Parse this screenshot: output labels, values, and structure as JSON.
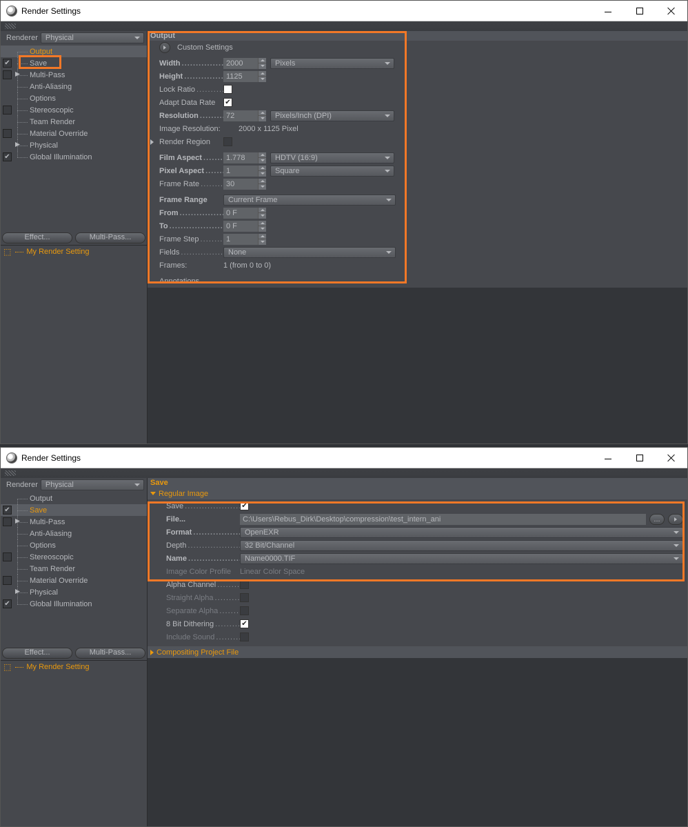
{
  "window1": {
    "title": "Render Settings",
    "renderer_label": "Renderer",
    "renderer_value": "Physical",
    "tree": [
      {
        "key": "output",
        "label": "Output",
        "checked": null,
        "accent": true,
        "bold": false,
        "selected": true,
        "expander": false
      },
      {
        "key": "save",
        "label": "Save",
        "checked": true,
        "accent": false,
        "bold": false,
        "selected": false,
        "expander": false
      },
      {
        "key": "multipass",
        "label": "Multi-Pass",
        "checked": false,
        "accent": false,
        "bold": false,
        "selected": false,
        "expander": true
      },
      {
        "key": "antialias",
        "label": "Anti-Aliasing",
        "checked": null,
        "accent": false,
        "bold": false,
        "selected": false,
        "expander": false
      },
      {
        "key": "options",
        "label": "Options",
        "checked": null,
        "accent": false,
        "bold": false,
        "selected": false,
        "expander": false
      },
      {
        "key": "stereo",
        "label": "Stereoscopic",
        "checked": false,
        "accent": false,
        "bold": false,
        "selected": false,
        "expander": false
      },
      {
        "key": "teamrender",
        "label": "Team Render",
        "checked": null,
        "accent": false,
        "bold": false,
        "selected": false,
        "expander": false
      },
      {
        "key": "matoverride",
        "label": "Material Override",
        "checked": false,
        "accent": false,
        "bold": false,
        "selected": false,
        "expander": false
      },
      {
        "key": "physical",
        "label": "Physical",
        "checked": null,
        "accent": false,
        "bold": false,
        "selected": false,
        "expander": true
      },
      {
        "key": "gi",
        "label": "Global Illumination",
        "checked": true,
        "accent": false,
        "bold": false,
        "selected": false,
        "expander": false
      }
    ],
    "btn_effect": "Effect...",
    "btn_multipass": "Multi-Pass...",
    "setting_name": "My Render Setting",
    "output": {
      "title": "Output",
      "preset": "Custom Settings",
      "width_label": "Width",
      "width": "2000",
      "width_unit": "Pixels",
      "height_label": "Height",
      "height": "1125",
      "lock_ratio_label": "Lock Ratio",
      "lock_ratio": false,
      "adapt_label": "Adapt Data Rate",
      "adapt": true,
      "resolution_label": "Resolution",
      "resolution": "72",
      "resolution_unit": "Pixels/Inch (DPI)",
      "image_res_label": "Image Resolution:",
      "image_res": "2000 x 1125 Pixel",
      "render_region_label": "Render Region",
      "render_region": false,
      "film_aspect_label": "Film Aspect",
      "film_aspect": "1.778",
      "film_aspect_preset": "HDTV (16:9)",
      "pixel_aspect_label": "Pixel Aspect",
      "pixel_aspect": "1",
      "pixel_aspect_preset": "Square",
      "frame_rate_label": "Frame Rate",
      "frame_rate": "30",
      "frame_range_label": "Frame Range",
      "frame_range": "Current Frame",
      "from_label": "From",
      "from": "0 F",
      "to_label": "To",
      "to": "0 F",
      "frame_step_label": "Frame Step",
      "frame_step": "1",
      "fields_label": "Fields",
      "fields": "None",
      "frames_label": "Frames:",
      "frames": "1 (from 0 to 0)",
      "annotations_label": "Annotations"
    }
  },
  "window2": {
    "title": "Render Settings",
    "renderer_label": "Renderer",
    "renderer_value": "Physical",
    "tree": [
      {
        "key": "output",
        "label": "Output",
        "checked": null,
        "accent": false,
        "bold": false,
        "selected": false,
        "expander": false
      },
      {
        "key": "save",
        "label": "Save",
        "checked": true,
        "accent": true,
        "bold": false,
        "selected": true,
        "expander": false
      },
      {
        "key": "multipass",
        "label": "Multi-Pass",
        "checked": false,
        "accent": false,
        "bold": false,
        "selected": false,
        "expander": true
      },
      {
        "key": "antialias",
        "label": "Anti-Aliasing",
        "checked": null,
        "accent": false,
        "bold": false,
        "selected": false,
        "expander": false
      },
      {
        "key": "options",
        "label": "Options",
        "checked": null,
        "accent": false,
        "bold": false,
        "selected": false,
        "expander": false
      },
      {
        "key": "stereo",
        "label": "Stereoscopic",
        "checked": false,
        "accent": false,
        "bold": false,
        "selected": false,
        "expander": false
      },
      {
        "key": "teamrender",
        "label": "Team Render",
        "checked": null,
        "accent": false,
        "bold": false,
        "selected": false,
        "expander": false
      },
      {
        "key": "matoverride",
        "label": "Material Override",
        "checked": false,
        "accent": false,
        "bold": false,
        "selected": false,
        "expander": false
      },
      {
        "key": "physical",
        "label": "Physical",
        "checked": null,
        "accent": false,
        "bold": false,
        "selected": false,
        "expander": true
      },
      {
        "key": "gi",
        "label": "Global Illumination",
        "checked": true,
        "accent": false,
        "bold": false,
        "selected": false,
        "expander": false
      }
    ],
    "btn_effect": "Effect...",
    "btn_multipass": "Multi-Pass...",
    "setting_name": "My Render Setting",
    "save": {
      "title": "Save",
      "section_regular": "Regular Image",
      "save_label": "Save",
      "save": true,
      "file_label": "File...",
      "file": "C:\\Users\\Rebus_Dirk\\Desktop\\compression\\test_intern_ani",
      "browse": "...",
      "format_label": "Format",
      "format": "OpenEXR",
      "depth_label": "Depth",
      "depth": "32 Bit/Channel",
      "name_label": "Name",
      "name": "Name0000.TIF",
      "color_profile_label": "Image Color Profile",
      "color_profile": "Linear Color Space",
      "alpha_label": "Alpha Channel",
      "alpha": false,
      "straight_alpha_label": "Straight Alpha",
      "straight_alpha": false,
      "separate_alpha_label": "Separate Alpha",
      "separate_alpha": false,
      "dither_label": "8 Bit Dithering",
      "dither": true,
      "sound_label": "Include Sound",
      "sound": false,
      "section_comp": "Compositing Project File"
    }
  }
}
